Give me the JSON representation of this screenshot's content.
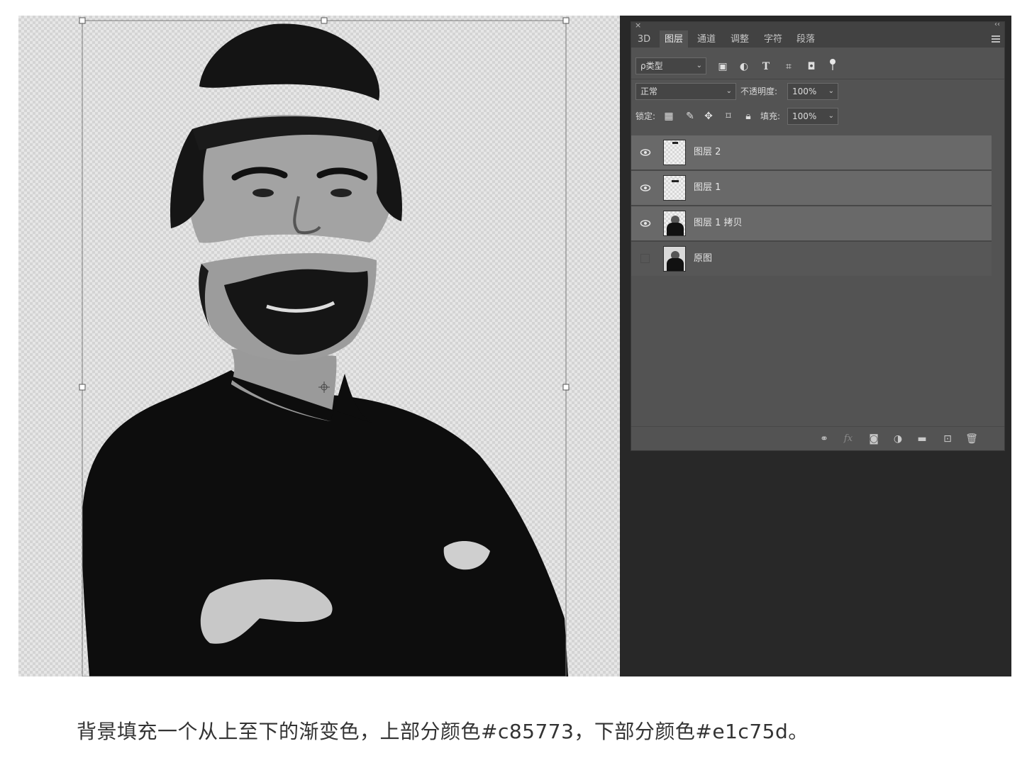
{
  "panel": {
    "tabs": [
      "3D",
      "图层",
      "通道",
      "调整",
      "字符",
      "段落"
    ],
    "active_tab": "图层",
    "filter_label": "ρ类型",
    "blend_mode": "正常",
    "opacity_label": "不透明度:",
    "opacity_value": "100%",
    "lock_label": "锁定:",
    "fill_label": "填充:",
    "fill_value": "100%",
    "layers": [
      {
        "name": "图层 2",
        "visible": true,
        "selected": true
      },
      {
        "name": "图层 1",
        "visible": true,
        "selected": true
      },
      {
        "name": "图层 1 拷贝",
        "visible": true,
        "selected": true
      },
      {
        "name": "原图",
        "visible": false,
        "selected": false
      }
    ],
    "icons": {
      "close": "×",
      "collapse": "‹‹",
      "kind_filters": [
        "image-filter-icon",
        "adjustment-filter-icon",
        "type-filter-icon",
        "shape-filter-icon",
        "smartobject-filter-icon",
        "filter-toggle-icon"
      ],
      "locks": [
        "lock-transparent-icon",
        "lock-paint-icon",
        "lock-move-icon",
        "lock-artboard-icon",
        "lock-all-icon"
      ],
      "bottom": [
        "link-layers-icon",
        "fx-icon",
        "add-mask-icon",
        "adjustment-layer-icon",
        "new-group-icon",
        "new-layer-icon",
        "delete-icon"
      ]
    }
  },
  "caption": "背景填充一个从上至下的渐变色，上部分颜色#c85773，下部分颜色#e1c75d。"
}
